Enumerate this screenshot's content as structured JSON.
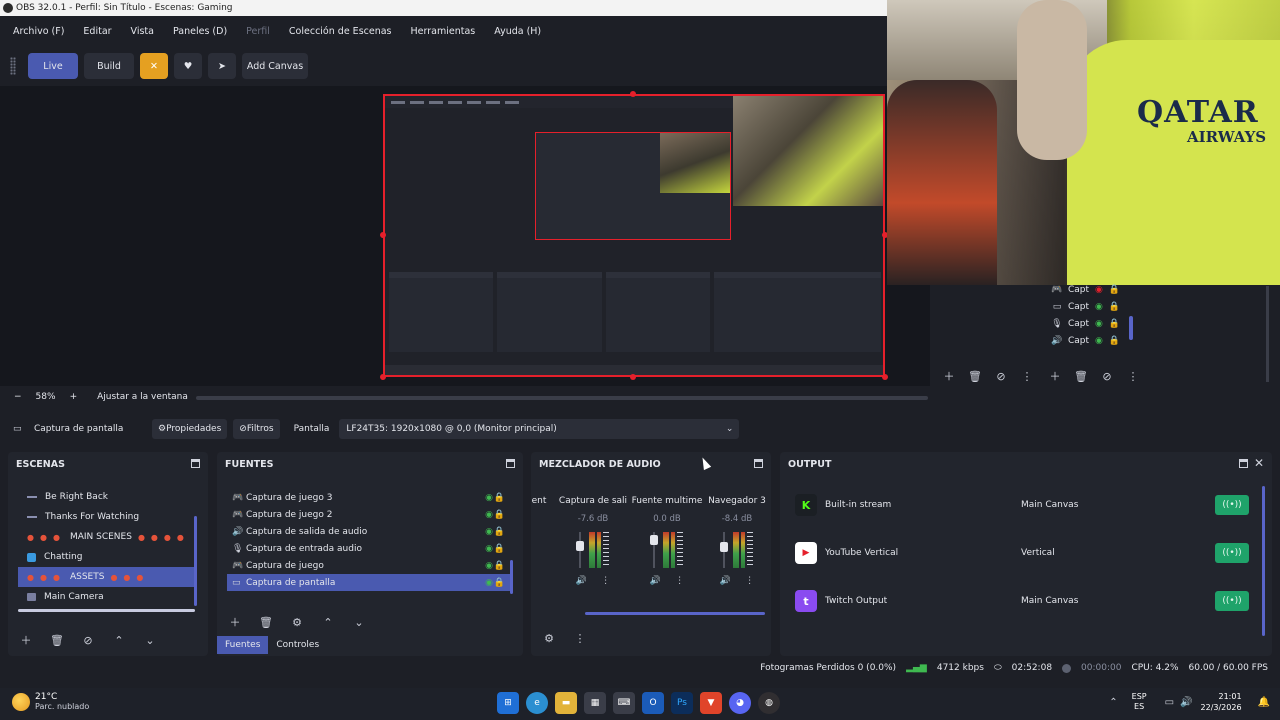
{
  "window": {
    "title": "OBS 32.0.1 - Perfil: Sin Título - Escenas: Gaming"
  },
  "menu": {
    "items": [
      "Archivo (F)",
      "Editar",
      "Vista",
      "Paneles (D)",
      "Perfil",
      "Colección de Escenas",
      "Herramientas",
      "Ayuda (H)"
    ]
  },
  "toolbar": {
    "live": "Live",
    "build": "Build",
    "add_canvas": "Add Canvas"
  },
  "preview": {
    "zoom": "58%",
    "fit_mode": "Ajustar a la ventana",
    "webcam_text": "QATAR",
    "webcam_sub": "AIRWAYS"
  },
  "under_sources": [
    {
      "label": "Capt",
      "icon": "gamepad-icon",
      "visible": false
    },
    {
      "label": "Capt",
      "icon": "monitor-icon",
      "visible": true
    },
    {
      "label": "Capt",
      "icon": "mic-icon",
      "visible": true
    },
    {
      "label": "Capt",
      "icon": "speaker-icon",
      "visible": true
    }
  ],
  "properties_bar": {
    "source": "Captura de pantalla",
    "properties": "Propiedades",
    "filters": "Filtros",
    "screen_label": "Pantalla",
    "screen_value": "LF24T35: 1920x1080 @ 0,0 (Monitor principal)"
  },
  "scenes": {
    "title": "ESCENAS",
    "items": [
      {
        "label": "Be Right Back",
        "kind": "dash"
      },
      {
        "label": "Thanks For Watching",
        "kind": "dash"
      },
      {
        "label": "MAIN SCENES",
        "kind": "dots"
      },
      {
        "label": "Chatting",
        "kind": "chat"
      },
      {
        "label": "ASSETS",
        "kind": "dots",
        "selected": true
      },
      {
        "label": "Main Camera",
        "kind": "cam"
      }
    ]
  },
  "sources": {
    "title": "FUENTES",
    "items": [
      {
        "label": "Captura de juego 3",
        "icon": "gamepad-icon"
      },
      {
        "label": "Captura de juego 2",
        "icon": "gamepad-icon"
      },
      {
        "label": "Captura de salida de audio",
        "icon": "speaker-icon"
      },
      {
        "label": "Captura de entrada audio",
        "icon": "mic-icon"
      },
      {
        "label": "Captura de juego",
        "icon": "gamepad-icon"
      },
      {
        "label": "Captura de pantalla",
        "icon": "monitor-icon",
        "selected": true
      }
    ],
    "tabs": [
      "Fuentes",
      "Controles"
    ]
  },
  "mixer": {
    "title": "MEZCLADOR DE AUDIO",
    "partial_label": "ent",
    "channels": [
      {
        "name": "Captura de sali",
        "db": "-7.6 dB",
        "level": 0.35
      },
      {
        "name": "Fuente multime",
        "db": "0.0 dB",
        "level": 0.1
      },
      {
        "name": "Navegador 3",
        "db": "-8.4 dB",
        "level": 0.4
      }
    ]
  },
  "output": {
    "title": "OUTPUT",
    "items": [
      {
        "service": "Built-in stream",
        "canvas": "Main Canvas",
        "logo": "kick"
      },
      {
        "service": "YouTube Vertical",
        "canvas": "Vertical",
        "logo": "yt"
      },
      {
        "service": "Twitch Output",
        "canvas": "Main Canvas",
        "logo": "tw"
      }
    ]
  },
  "status": {
    "dropped": "Fotogramas Perdidos 0 (0.0%)",
    "bitrate": "4712 kbps",
    "stream_time": "02:52:08",
    "rec_time": "00:00:00",
    "cpu": "CPU: 4.2%",
    "fps": "60.00 / 60.00 FPS"
  },
  "taskbar": {
    "temp": "21°C",
    "weather": "Parc. nublado",
    "lang1": "ESP",
    "lang2": "ES",
    "time": "21:01",
    "date": "22/3/2026"
  }
}
